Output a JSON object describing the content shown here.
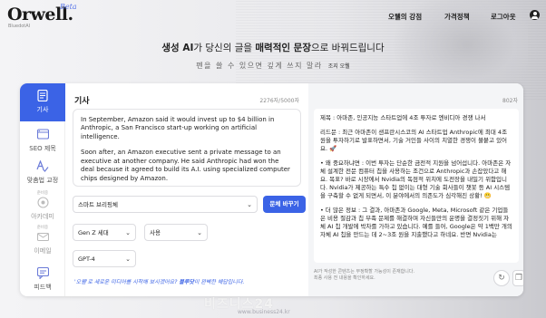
{
  "header": {
    "logo": "Orwell.",
    "logo_badge": "Beta",
    "logo_sub": "BluedotAI",
    "nav": [
      "오웰의 강점",
      "가격정책",
      "로그아웃"
    ]
  },
  "hero": {
    "headline_prefix": "생성 AI",
    "headline_mid": "가 당신의 글을 ",
    "headline_bold": "매력적인 문장",
    "headline_suffix": "으로 바꿔드립니다",
    "subline": "펜을 쓸 수 있으면 깊게 쓰지 말라",
    "subline_author": "조지 오웰"
  },
  "sidebar": {
    "items": [
      {
        "label": "기사",
        "icon": "document-icon",
        "active": true
      },
      {
        "label": "SEO 제목",
        "icon": "seo-icon",
        "active": false
      },
      {
        "label": "맞춤법 교정",
        "icon": "spellcheck-icon",
        "active": false
      },
      {
        "label": "아카데미",
        "icon": "academy-icon",
        "tag": "준비중",
        "disabled": true
      },
      {
        "label": "이메일",
        "icon": "email-icon",
        "tag": "준비중",
        "disabled": true
      },
      {
        "label": "피드백",
        "icon": "feedback-icon",
        "active": false
      }
    ]
  },
  "editor": {
    "title": "기사",
    "count": "2276자/5000자",
    "paragraph1": "In September, Amazon said it would invest up to $4 billion in Anthropic, a San Francisco start-up working on artificial intelligence.",
    "paragraph2": "Soon after, an Amazon executive sent a private message to an executive at another company. He said Anthropic had won the deal because it agreed to build its A.I. using specialized computer chips designed by Amazon.",
    "style_select": "스마트 브리핑체",
    "convert_button": "문체 바꾸기",
    "grade_select": "Gen Z 세대",
    "usage_select": "사용",
    "model_select": "GPT-4",
    "hint_prefix": "'오웰'로 새로운 미디어를 시작해 보시겠어요? ",
    "hint_bold": "블루닷",
    "hint_suffix": "이 완벽한 해답입니다."
  },
  "output": {
    "count": "802자",
    "p1": "제목 : 아마존, 인공지능 스타트업에 4조 투자로 엔비디아 경쟁 나서",
    "p2": "리드문 : 최근 아마존이 샌프란시스코의 AI 스타트업 Anthropic에 최대 4조 원을 투자하기로 발표하면서, 기술 거인들 사이의 치열한 경쟁이 불붙고 있어요. 🚀",
    "p3": "• 왜 중요하냐면 : 이번 투자는 단순한 금전적 지원을 넘어섭니다. 아마존은 자체 설계한 전문 컴퓨터 칩을 사용하는 조건으로 Anthropic과 손잡았다고 해요. 목표? 바로 시장에서 Nvidia의 독점적 위치에 도전장을 내밀기 위함입니다. Nvidia가 제공하는 특수 칩 없이는 대형 기술 회사들이 챗봇 등 AI 시스템을 구축할 수 없게 되면서, 이 분야에서의 의존도가 심각해진 상황! 😬",
    "p4": "• 더 많은 정보 : 그 결과, 아마존과 Google, Meta, Microsoft 같은 기업들은 비용 절감과 칩 부족 문제를 해결하며 자신들만의 운명을 결정짓기 위해 자체 AI 칩 개발에 박차를 가하고 있습니다. 예를 들어, Google은 약 1백만 개의 자체 AI 칩을 만드는 데 2~3조 원을 지출했다고 하네요. 반면 Nvidia는",
    "note_line1": "AI가 작성한 콘텐츠는 부정확할 가능성이 존재합니다.",
    "note_line2": "최종 사용 전 내용을 확인하세요."
  },
  "watermark": {
    "main": "비즈니스24",
    "sub": "www.business24.kr"
  }
}
